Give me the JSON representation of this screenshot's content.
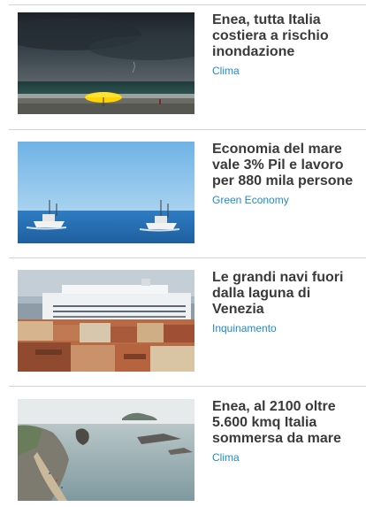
{
  "articles": [
    {
      "title": "Enea, tutta Italia costiera a rischio inondazione",
      "category": "Clima",
      "image": "stormy-beach-yellow-umbrella"
    },
    {
      "title": "Economia del mare vale 3% Pil e lavoro per 880 mila persone",
      "category": "Green Economy",
      "image": "fishing-boats-at-sea"
    },
    {
      "title": "Le grandi navi fuori dalla laguna di Venezia",
      "category": "Inquinamento",
      "image": "cruise-ship-venice"
    },
    {
      "title": "Enea, al 2100 oltre 5.600 kmq Italia sommersa da mare",
      "category": "Clima",
      "image": "coastal-cove-islands"
    }
  ],
  "colors": {
    "title": "#3a3a3a",
    "category_link": "#1f8ad0",
    "divider": "#d4d4d4"
  }
}
